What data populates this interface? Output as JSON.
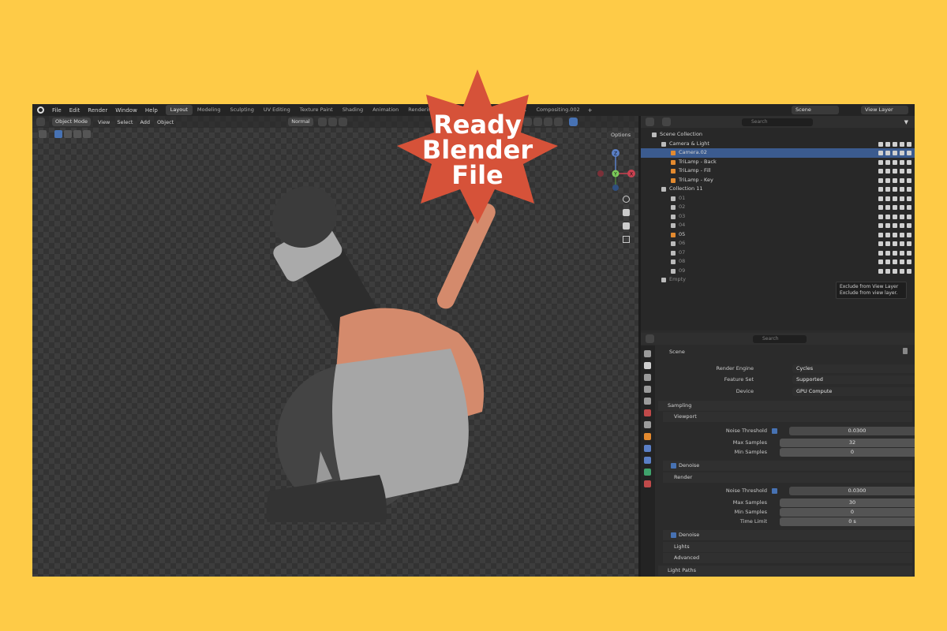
{
  "badge": {
    "line1": "Ready",
    "line2": "Blender",
    "line3": "File"
  },
  "topbar": {
    "menus": [
      "File",
      "Edit",
      "Render",
      "Window",
      "Help"
    ],
    "tabs": [
      "Layout",
      "Modeling",
      "Sculpting",
      "UV Editing",
      "Texture Paint",
      "Shading",
      "Animation",
      "Rendering",
      "Co",
      "ing.001",
      "Compositing.002"
    ],
    "active_tab": "Layout",
    "scene": "Scene",
    "view_layer": "View Layer"
  },
  "viewport": {
    "mode": "Object Mode",
    "menus": [
      "View",
      "Select",
      "Add",
      "Object"
    ],
    "orientation": "Normal",
    "options": "Options",
    "gizmo": {
      "z": "Z",
      "y": "Y",
      "x": "X"
    }
  },
  "outliner": {
    "search_placeholder": "Search",
    "rows": [
      {
        "label": "Scene Collection",
        "indent": 0
      },
      {
        "label": "Camera & Light",
        "indent": 1
      },
      {
        "label": "Camera.02",
        "indent": 2,
        "selected": true
      },
      {
        "label": "TriLamp - Back",
        "indent": 2
      },
      {
        "label": "TriLamp - Fill",
        "indent": 2
      },
      {
        "label": "TriLamp - Key",
        "indent": 2
      },
      {
        "label": "Collection 11",
        "indent": 1
      },
      {
        "label": "01",
        "indent": 2,
        "dim": true
      },
      {
        "label": "02",
        "indent": 2,
        "dim": true
      },
      {
        "label": "03",
        "indent": 2,
        "dim": true
      },
      {
        "label": "04",
        "indent": 2,
        "dim": true
      },
      {
        "label": "05",
        "indent": 2
      },
      {
        "label": "06",
        "indent": 2,
        "dim": true
      },
      {
        "label": "07",
        "indent": 2,
        "dim": true
      },
      {
        "label": "08",
        "indent": 2,
        "dim": true
      },
      {
        "label": "09",
        "indent": 2,
        "dim": true
      },
      {
        "label": "Empty",
        "indent": 1,
        "dim": true
      }
    ],
    "tooltip_line1": "Exclude from View Layer",
    "tooltip_line2": "Exclude from view layer."
  },
  "properties": {
    "search_placeholder": "Search",
    "context": "Scene",
    "render_engine_label": "Render Engine",
    "render_engine": "Cycles",
    "feature_set_label": "Feature Set",
    "feature_set": "Supported",
    "device_label": "Device",
    "device": "GPU Compute",
    "sampling": "Sampling",
    "viewport": "Viewport",
    "noise_threshold_label": "Noise Threshold",
    "vp_noise_threshold": "0.0300",
    "max_samples_label": "Max Samples",
    "vp_max_samples": "32",
    "min_samples_label": "Min Samples",
    "vp_min_samples": "0",
    "denoise": "Denoise",
    "render": "Render",
    "r_noise_threshold": "0.0300",
    "r_max_samples": "30",
    "r_min_samples": "0",
    "time_limit_label": "Time Limit",
    "r_time_limit": "0 s",
    "lights": "Lights",
    "advanced": "Advanced",
    "light_paths": "Light Paths"
  },
  "colors": {
    "background": "#fecb47",
    "badge": "#d65239",
    "accent": "#4772b3"
  }
}
